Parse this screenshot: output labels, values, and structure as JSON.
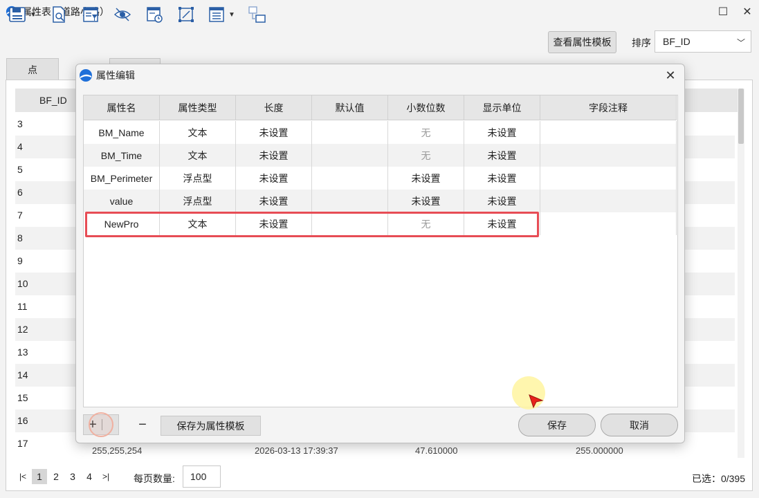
{
  "window": {
    "title": "属性表（道路小路）",
    "maximize_glyph": "☐",
    "close_glyph": "✕"
  },
  "toolbar": {
    "template_button": "查看属性模板",
    "sort_label": "排序",
    "sort_value": "BF_ID"
  },
  "tabs": [
    {
      "label": "点"
    },
    {
      "label": ""
    }
  ],
  "background_table": {
    "header": "BF_ID",
    "rows": [
      "3",
      "4",
      "5",
      "6",
      "7",
      "8",
      "9",
      "10",
      "11",
      "12",
      "13",
      "14",
      "15",
      "16",
      "17"
    ],
    "last_row_fragments": [
      "255,255,254",
      "2026-03-13 17:39:37",
      "47.610000",
      "255.000000"
    ]
  },
  "pager": {
    "pages": [
      "1",
      "2",
      "3",
      "4"
    ],
    "active_page": "1",
    "per_page_label": "每页数量:",
    "per_page_value": "100",
    "selected_count": "已选：0/395"
  },
  "dialog": {
    "title": "属性编辑",
    "columns": [
      "属性名",
      "属性类型",
      "长度",
      "默认值",
      "小数位数",
      "显示单位",
      "字段注释"
    ],
    "rows": [
      {
        "name": "BM_Name",
        "type": "文本",
        "length": "未设置",
        "default": "",
        "decimals": "无",
        "unit": "未设置",
        "comment": ""
      },
      {
        "name": "BM_Time",
        "type": "文本",
        "length": "未设置",
        "default": "",
        "decimals": "无",
        "unit": "未设置",
        "comment": ""
      },
      {
        "name": "BM_Perimeter",
        "type": "浮点型",
        "length": "未设置",
        "default": "",
        "decimals": "未设置",
        "unit": "未设置",
        "comment": ""
      },
      {
        "name": "value",
        "type": "浮点型",
        "length": "未设置",
        "default": "",
        "decimals": "未设置",
        "unit": "未设置",
        "comment": ""
      },
      {
        "name": "NewPro",
        "type": "文本",
        "length": "未设置",
        "default": "",
        "decimals": "无",
        "unit": "未设置",
        "comment": ""
      }
    ],
    "add_label": "+",
    "remove_label": "−",
    "save_template_label": "保存为属性模板",
    "save_label": "保存",
    "cancel_label": "取消"
  },
  "colors": {
    "highlight": "#e74c55",
    "header_bg": "#e6e6e6",
    "accent": "#1e6fd9"
  }
}
